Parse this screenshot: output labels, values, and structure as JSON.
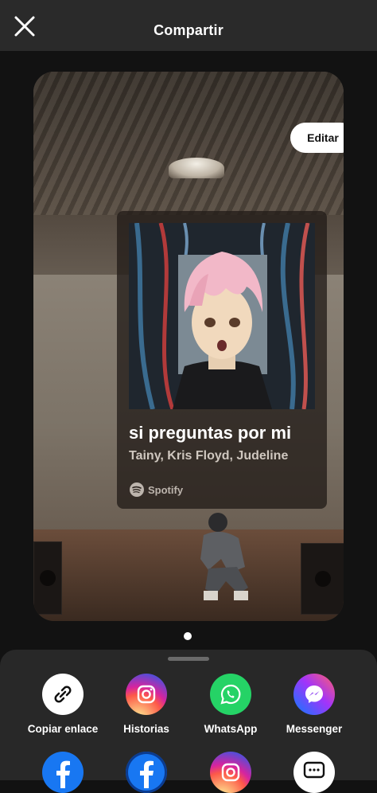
{
  "header": {
    "title": "Compartir",
    "close_icon": "close-icon"
  },
  "preview": {
    "edit_label": "Editar",
    "song_title": "si preguntas por mi",
    "artists": "Tainy, Kris Floyd, Judeline",
    "brand": "Spotify"
  },
  "pager": {
    "current": 1
  },
  "share": {
    "targets": [
      {
        "label": "Copiar enlace",
        "icon": "link-icon"
      },
      {
        "label": "Historias",
        "icon": "instagram-icon"
      },
      {
        "label": "WhatsApp",
        "icon": "whatsapp-icon"
      },
      {
        "label": "Messenger",
        "icon": "messenger-icon"
      }
    ],
    "more_targets": [
      "facebook-icon",
      "facebook-icon",
      "instagram-icon",
      "messages-icon"
    ]
  },
  "colors": {
    "header_bg": "#2a2a2a",
    "sheet_bg": "#282828",
    "whatsapp": "#25d366",
    "facebook": "#1877f2"
  }
}
